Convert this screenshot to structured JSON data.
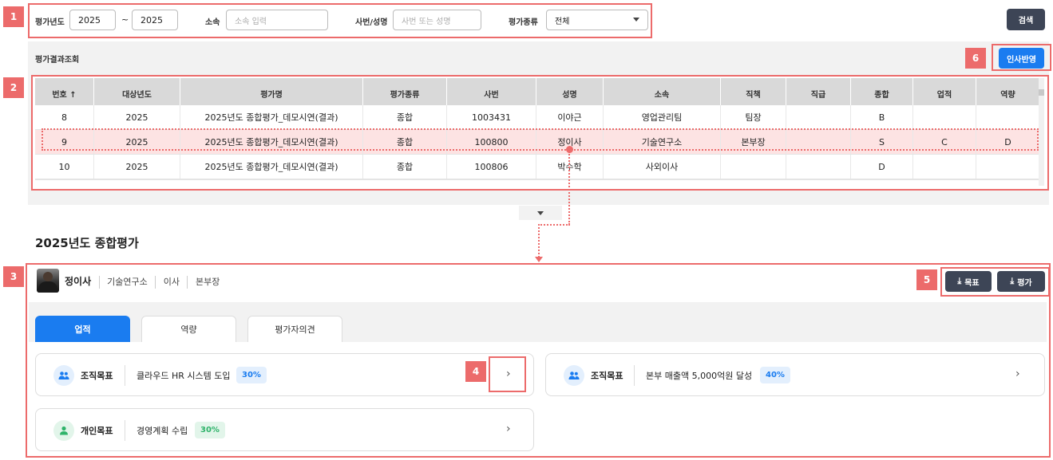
{
  "search": {
    "year_label": "평가년도",
    "year_from": "2025",
    "year_dash": "~",
    "year_to": "2025",
    "dept_label": "소속",
    "dept_placeholder": "소속 입력",
    "emp_label": "사번/성명",
    "emp_placeholder": "사번 또는 성명",
    "type_label": "평가종류",
    "type_value": "전체",
    "search_button": "검색"
  },
  "section_title": "평가결과조회",
  "apply_button": "인사반영",
  "grid": {
    "columns": [
      "번호 ↑",
      "대상년도",
      "평가명",
      "평가종류",
      "사번",
      "성명",
      "소속",
      "직책",
      "직급",
      "종합",
      "업적",
      "역량"
    ],
    "rows": [
      [
        "8",
        "2025",
        "2025년도 종합평가_데모시연(결과)",
        "종합",
        "1003431",
        "이야근",
        "영업관리팀",
        "팀장",
        "",
        "B",
        "",
        ""
      ],
      [
        "9",
        "2025",
        "2025년도 종합평가_데모시연(결과)",
        "종합",
        "100800",
        "정이사",
        "기술연구소",
        "본부장",
        "",
        "S",
        "C",
        "D"
      ],
      [
        "10",
        "2025",
        "2025년도 종합평가_데모시연(결과)",
        "종합",
        "100806",
        "박수학",
        "사외이사",
        "",
        "",
        "D",
        "",
        ""
      ]
    ]
  },
  "detail": {
    "title": "2025년도 종합평가",
    "name": "정이사",
    "dept": "기술연구소",
    "rank": "이사",
    "position": "본부장",
    "goal_button": "목표",
    "eval_button": "평가",
    "tabs": [
      "업적",
      "역량",
      "평가자의견"
    ],
    "cards": [
      {
        "kind": "조직목표",
        "name": "클라우드 HR 시스템 도입",
        "pct": "30%"
      },
      {
        "kind": "조직목표",
        "name": "본부 매출액 5,000억원 달성",
        "pct": "40%"
      },
      {
        "kind": "개인목표",
        "name": "경영계획 수립",
        "pct": "30%"
      }
    ]
  },
  "annotations": [
    "1",
    "2",
    "3",
    "4",
    "5",
    "6"
  ],
  "colors": {
    "accent": "#1a7cf0",
    "highlight": "#ec6b6b",
    "dark_button": "#3d4556",
    "personal_green": "#2fb36a"
  }
}
